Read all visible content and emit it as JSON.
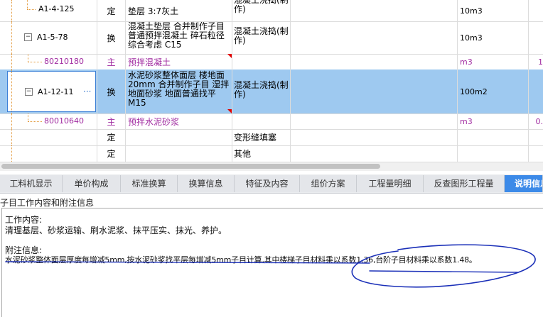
{
  "grid": {
    "rows": [
      {
        "code": "A1-4-125",
        "category": "定",
        "name": "垫层 3:7灰土",
        "major": "混凝土浇捣(制作)",
        "unit": "10m3",
        "qty": ""
      },
      {
        "code": "A1-5-78",
        "category": "换",
        "name": "混凝土垫层  合并制作子目 普通预拌混凝土 碎石粒径综合考虑 C15",
        "major": "混凝土浇捣(制作)",
        "unit": "10m3",
        "qty": ""
      },
      {
        "code": "80210180",
        "category": "主",
        "name": "预拌混凝土",
        "major": "",
        "unit": "m3",
        "qty": "1"
      },
      {
        "code": "A1-12-11",
        "category": "换",
        "name": "水泥砂浆整体面层 楼地面 20mm  合并制作子目 湿拌地面砂浆 地面普通找平 M15",
        "major": "混凝土浇捣(制作)",
        "unit": "100m2",
        "qty": "",
        "ellipsis": "···"
      },
      {
        "code": "80010640",
        "category": "主",
        "name": "预拌水泥砂浆",
        "major": "",
        "unit": "m3",
        "qty": "0."
      },
      {
        "code": "",
        "category": "定",
        "name": "",
        "major": "变形缝填塞",
        "unit": "",
        "qty": ""
      },
      {
        "code": "",
        "category": "定",
        "name": "",
        "major": "其他",
        "unit": "",
        "qty": ""
      }
    ]
  },
  "tabs": [
    {
      "label": "工料机显示"
    },
    {
      "label": "单价构成"
    },
    {
      "label": "标准换算"
    },
    {
      "label": "换算信息"
    },
    {
      "label": "特征及内容"
    },
    {
      "label": "组价方案"
    },
    {
      "label": "工程量明细"
    },
    {
      "label": "反查图形工程量"
    },
    {
      "label": "说明信息"
    }
  ],
  "panel": {
    "title": "子目工作内容和附注信息",
    "work_heading": "工作内容:",
    "work_text": "清理基层、砂浆运输、刷水泥浆、抹平压实、抹光、养护。",
    "note_heading": "附注信息:",
    "note_text": "水泥砂浆整体面层厚度每增减5mm,按水泥砂浆找平层每增减5mm子目计算,其中楼梯子目材料乘以系数1.36,台阶子目材料乘以系数1.48。"
  },
  "colors": {
    "selected_row": "#9ec9f0",
    "active_tab": "#3c8ae8",
    "main_material": "#a02aa0",
    "annotation": "#1a2fb8"
  }
}
